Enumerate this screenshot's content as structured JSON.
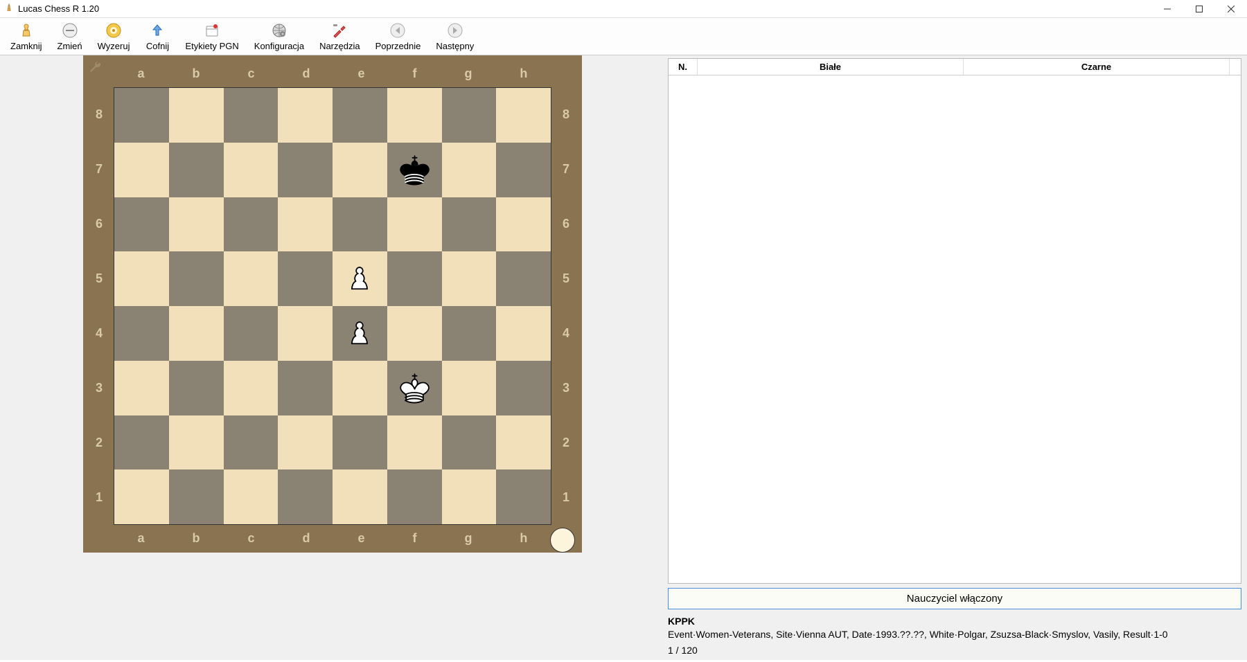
{
  "window": {
    "title": "Lucas Chess R 1.20"
  },
  "toolbar": {
    "close": "Zamknij",
    "change": "Zmień",
    "reset": "Wyzeruj",
    "undo": "Cofnij",
    "pgn_labels": "Etykiety PGN",
    "config": "Konfiguracja",
    "tools": "Narzędzia",
    "prev": "Poprzednie",
    "next": "Następny"
  },
  "board": {
    "files": [
      "a",
      "b",
      "c",
      "d",
      "e",
      "f",
      "g",
      "h"
    ],
    "ranks": [
      "8",
      "7",
      "6",
      "5",
      "4",
      "3",
      "2",
      "1"
    ],
    "position": [
      {
        "square": "f7",
        "piece": "king",
        "color": "black"
      },
      {
        "square": "e5",
        "piece": "pawn",
        "color": "white"
      },
      {
        "square": "e4",
        "piece": "pawn",
        "color": "white"
      },
      {
        "square": "f3",
        "piece": "king",
        "color": "white"
      }
    ],
    "side_to_move": "white"
  },
  "moves_table": {
    "col_n": "N.",
    "col_white": "Białe",
    "col_black": "Czarne"
  },
  "teacher_button": "Nauczyciel włączony",
  "game_info": {
    "title": "KPPK",
    "details": "Event·Women-Veterans, Site·Vienna AUT, Date·1993.??.??, White·Polgar, Zsuzsa-Black·Smyslov, Vasily, Result·1-0",
    "counter": "1 / 120"
  },
  "icons": {
    "wrench": "wrench-icon",
    "app": "app-icon"
  }
}
